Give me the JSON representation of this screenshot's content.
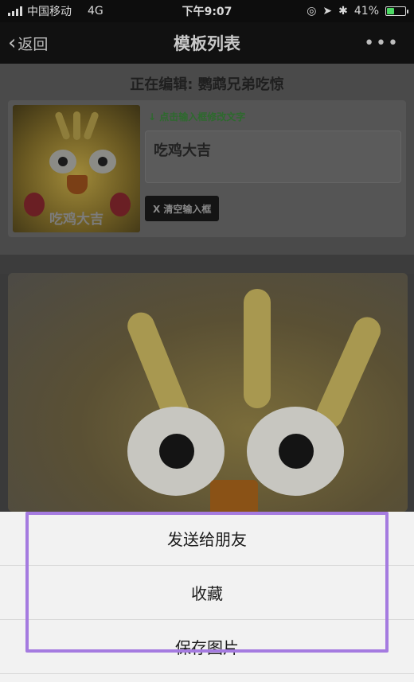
{
  "status_bar": {
    "carrier": "中国移动",
    "network": "4G",
    "time": "下午9:07",
    "battery_percent": "41%",
    "battery_level": 0.41,
    "battery_color": "#4cd964"
  },
  "nav": {
    "back_label": "返回",
    "title": "模板列表",
    "more_label": "•••"
  },
  "editor": {
    "editing_title": "正在编辑: 鹦鹉兄弟吃惊",
    "thumb_caption": "吃鸡大吉",
    "hint": "↓ 点击输入框修改文字",
    "input_value": "吃鸡大吉",
    "clear_button": "X 清空输入框"
  },
  "action_sheet": {
    "items": [
      {
        "label": "发送给朋友"
      },
      {
        "label": "收藏"
      },
      {
        "label": "保存图片"
      }
    ],
    "highlight_color": "#a57be0"
  }
}
